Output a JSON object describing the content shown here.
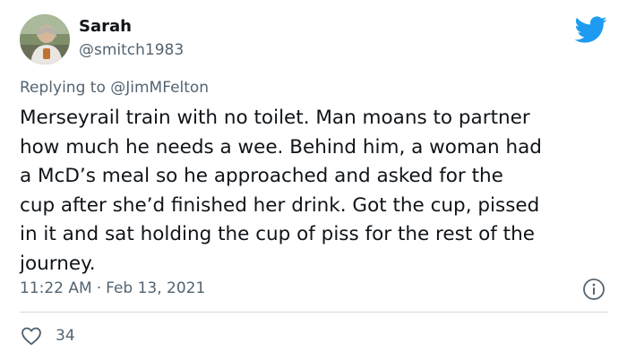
{
  "author": {
    "display_name": "Sarah",
    "handle": "@smitch1983",
    "avatar_icon": "profile-photo"
  },
  "brand": {
    "logo_icon": "twitter-bird-icon",
    "color": "#1d9bf0"
  },
  "reply": {
    "prefix": "Replying to ",
    "mention": "@JimMFelton"
  },
  "tweet": {
    "text": "Merseyrail train with no toilet. Man moans to partner\nhow much he needs a wee. Behind him, a woman had\na McD’s meal so he approached and asked for the\ncup after she’d finished her drink. Got the cup, pissed\nin it and sat holding the cup of piss for the rest of the\njourney.",
    "time": "11:22 AM",
    "separator": "·",
    "date": "Feb 13, 2021"
  },
  "actions": {
    "like_icon": "heart-outline-icon",
    "like_count": "34",
    "info_icon": "info-circle-icon"
  },
  "colors": {
    "text_primary": "#0f1419",
    "text_secondary": "#536471",
    "divider": "#cfd9de",
    "like_icon": "#536471"
  }
}
